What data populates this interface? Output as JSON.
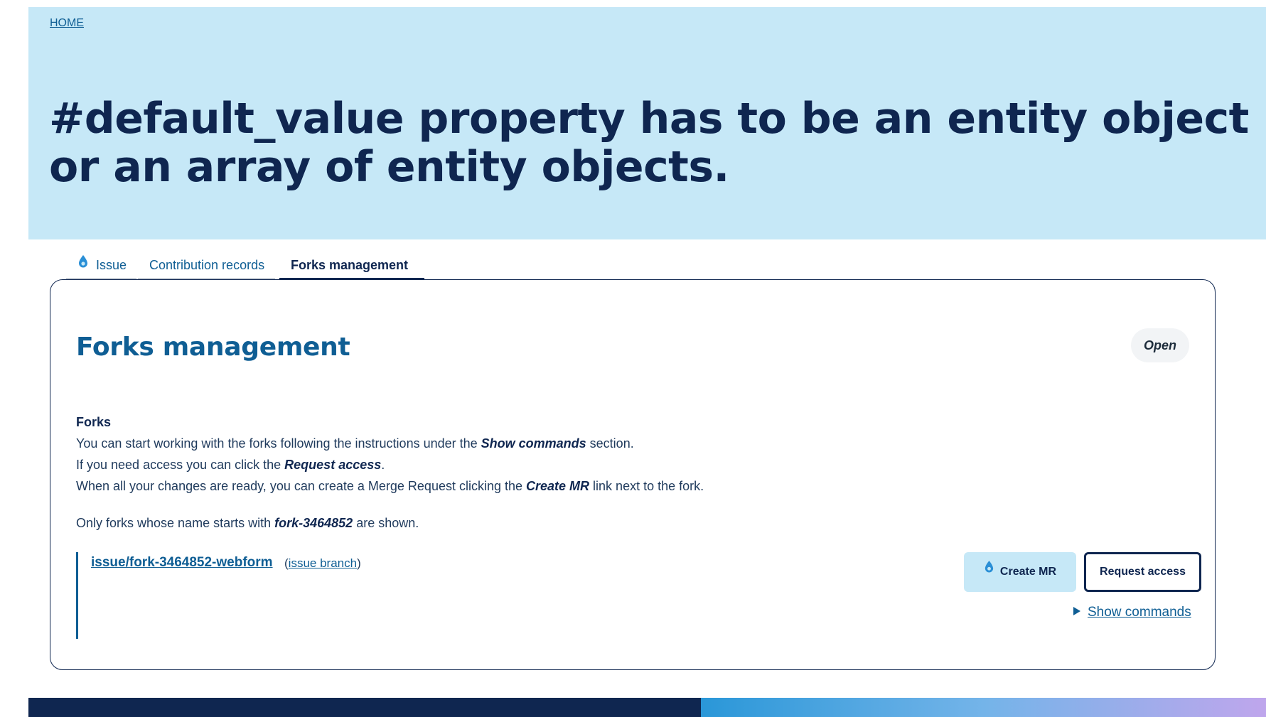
{
  "breadcrumb": {
    "home_label": "HOME"
  },
  "page": {
    "title": "#default_value property has to be an entity object or an array of entity objects."
  },
  "tabs": [
    {
      "label": "Issue",
      "icon": "drop-icon",
      "active": false
    },
    {
      "label": "Contribution records",
      "active": false
    },
    {
      "label": "Forks management",
      "active": true
    }
  ],
  "panel": {
    "title": "Forks management",
    "status": "Open",
    "forks_heading": "Forks",
    "line1": {
      "pre": "You can start working with the forks following the instructions under the ",
      "em": "Show commands",
      "post": " section."
    },
    "line2": {
      "pre": "If you need access you can click the ",
      "em": "Request access",
      "post": "."
    },
    "line3": {
      "pre": "When all your changes are ready, you can create a Merge Request clicking the ",
      "em": "Create MR",
      "post": " link next to the fork."
    },
    "line4": {
      "pre": "Only forks whose name starts with ",
      "em": "fork-3464852",
      "post": " are shown."
    }
  },
  "fork": {
    "name": "issue/fork-3464852-webform",
    "branch_open": "(",
    "branch_label": "issue branch",
    "branch_close": ")",
    "create_mr_label": "Create MR",
    "request_access_label": "Request access",
    "show_commands_label": "Show commands"
  },
  "colors": {
    "hero_bg": "#c6e8f7",
    "navy": "#0f2650",
    "link_blue": "#0f5e94",
    "drop_icon": "#2a8fd6"
  }
}
